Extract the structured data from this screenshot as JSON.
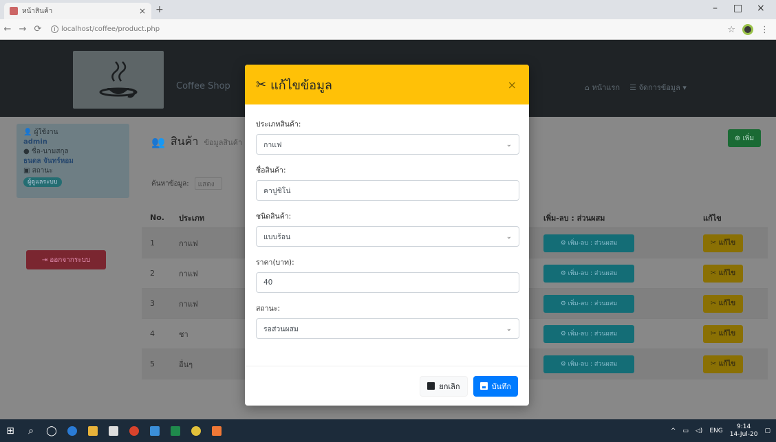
{
  "browser": {
    "tab_title": "หน้าสินค้า",
    "tab_close": "×",
    "new_tab": "+",
    "url": "localhost/coffee/product.php",
    "win_min": "–",
    "win_max": "□",
    "win_close": "×"
  },
  "navbar": {
    "brand": "Coffee Shop",
    "link_home": "หน้าแรก",
    "link_manage": "จัดการข้อมูล ▾"
  },
  "sidebar": {
    "user_label": "ผู้ใช้งาน",
    "username": "admin",
    "name_label": "ชื่อ-นามสกุล",
    "fullname": "ธนดล จันทร์หอม",
    "role_label": "สถานะ",
    "role_value": "ผู้ดูแลระบบ",
    "logout": "ออกจากระบบ"
  },
  "content": {
    "title": "สินค้า",
    "subtitle": "ข้อมูลสินค้า",
    "add_button": "เพิ่ม",
    "search_label": "ค้นหาข้อมูล:",
    "search_value": "แสดง",
    "columns": {
      "no": "No.",
      "type": "ประเภท",
      "manage": "เพิ่ม-ลบ : ส่วนผสม",
      "edit": "แก้ไข"
    },
    "rows": [
      {
        "no": "1",
        "type": "กาแฟ",
        "manage": "เพิ่ม-ลบ : ส่วนผสม",
        "edit": "แก้ไข"
      },
      {
        "no": "2",
        "type": "กาแฟ",
        "manage": "เพิ่ม-ลบ : ส่วนผสม",
        "edit": "แก้ไข"
      },
      {
        "no": "3",
        "type": "กาแฟ",
        "manage": "เพิ่ม-ลบ : ส่วนผสม",
        "edit": "แก้ไข"
      },
      {
        "no": "4",
        "type": "ชา",
        "manage": "เพิ่ม-ลบ : ส่วนผสม",
        "edit": "แก้ไข"
      },
      {
        "no": "5",
        "type": "อื่นๆ",
        "manage": "เพิ่ม-ลบ : ส่วนผสม",
        "edit": "แก้ไข"
      }
    ]
  },
  "modal": {
    "title": "แก้ไขข้อมูล",
    "close": "×",
    "fields": {
      "category_label": "ประเภทสินค้า:",
      "category_value": "กาแฟ",
      "name_label": "ชื่อสินค้า:",
      "name_value": "คาปูชิโน่",
      "kind_label": "ชนิดสินค้า:",
      "kind_value": "แบบร้อน",
      "price_label": "ราคา(บาท):",
      "price_value": "40",
      "status_label": "สถานะ:",
      "status_value": "รอส่วนผสม"
    },
    "cancel_button": "ยกเลิก",
    "save_button": "บันทึก"
  },
  "taskbar": {
    "lang": "ENG",
    "time": "9:14",
    "date": "14-Jul-20"
  },
  "colors": {
    "modal_header": "#ffc107",
    "save_button": "#007bff",
    "navbar": "#1f2326"
  }
}
